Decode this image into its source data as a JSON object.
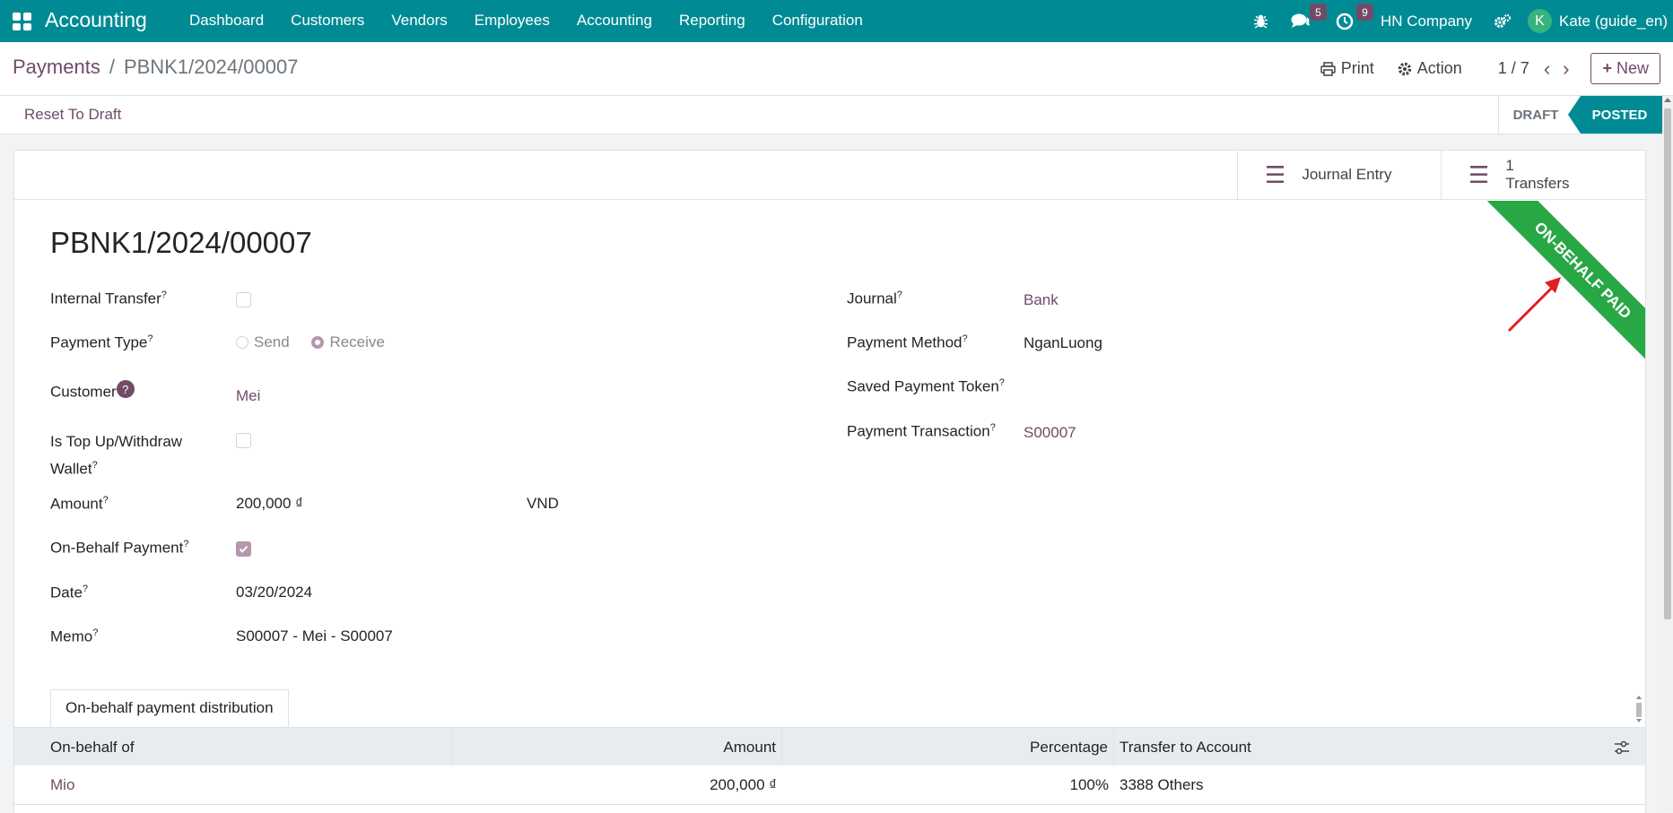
{
  "navbar": {
    "app_name": "Accounting",
    "menu": [
      "Dashboard",
      "Customers",
      "Vendors",
      "Employees",
      "Accounting",
      "Reporting",
      "Configuration"
    ],
    "messages_count": "5",
    "activities_count": "9",
    "company": "HN Company",
    "user_initial": "K",
    "user_name": "Kate (guide_en)",
    "bg_color": "#008b94"
  },
  "breadcrumb": {
    "parent": "Payments",
    "current": "PBNK1/2024/00007"
  },
  "control": {
    "print_label": "Print",
    "action_label": "Action",
    "pager": "1 / 7",
    "new_label": "New"
  },
  "statusbar": {
    "reset_label": "Reset To Draft",
    "stages": [
      "DRAFT",
      "POSTED"
    ],
    "active_stage": "POSTED"
  },
  "smart_buttons": {
    "journal_entry": "Journal Entry",
    "transfers_count": "1",
    "transfers_label": "Transfers"
  },
  "ribbon": "ON-BEHALF PAID",
  "record": {
    "title": "PBNK1/2024/00007"
  },
  "fields": {
    "internal_transfer_label": "Internal Transfer",
    "payment_type_label": "Payment Type",
    "payment_type_send": "Send",
    "payment_type_receive": "Receive",
    "customer_label": "Customer",
    "customer_value": "Mei",
    "top_up_label_1": "Is Top Up/Withdraw",
    "top_up_label_2": "Wallet",
    "amount_label": "Amount",
    "amount_value": "200,000 ₫",
    "currency_value": "VND",
    "on_behalf_label": "On-Behalf Payment",
    "date_label": "Date",
    "date_value": "03/20/2024",
    "memo_label": "Memo",
    "memo_value": "S00007 - Mei - S00007",
    "journal_label": "Journal",
    "journal_value": "Bank",
    "payment_method_label": "Payment Method",
    "payment_method_value": "NganLuong",
    "saved_token_label": "Saved Payment Token",
    "payment_transaction_label": "Payment Transaction",
    "payment_transaction_value": "S00007"
  },
  "notebook": {
    "tab_label": "On-behalf payment distribution",
    "columns": [
      "On-behalf of",
      "Amount",
      "Percentage",
      "Transfer to Account"
    ],
    "rows": [
      {
        "on_behalf_of": "Mio",
        "amount": "200,000 ₫",
        "percentage": "100%",
        "account": "3388 Others"
      }
    ]
  }
}
